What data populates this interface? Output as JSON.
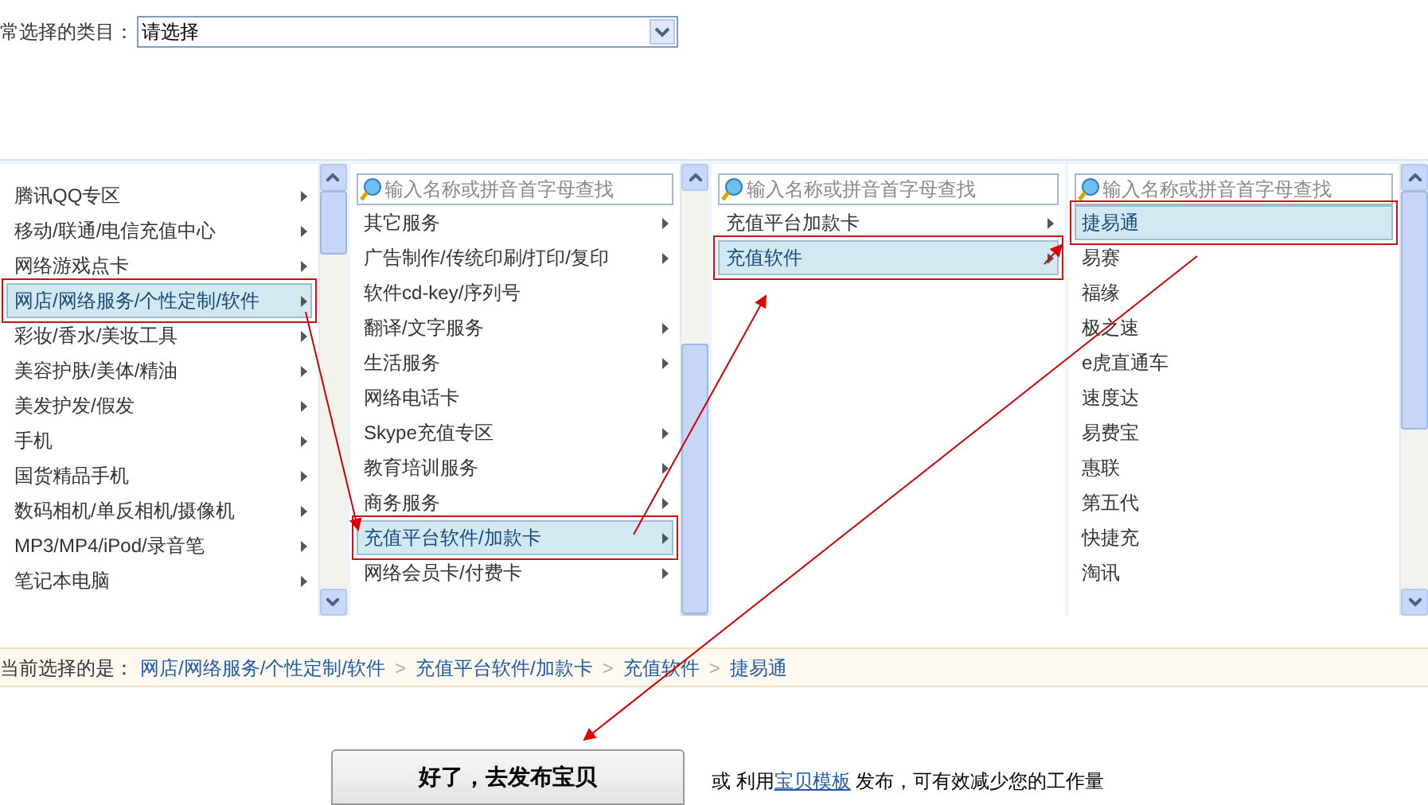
{
  "category_select": {
    "label": "常选择的类目：",
    "value": "请选择"
  },
  "columns": [
    {
      "scrollbar": true,
      "items": [
        {
          "label": "腾讯QQ专区",
          "has_children": true,
          "selected": false
        },
        {
          "label": "移动/联通/电信充值中心",
          "has_children": true,
          "selected": false
        },
        {
          "label": "网络游戏点卡",
          "has_children": true,
          "selected": false
        },
        {
          "label": "网店/网络服务/个性定制/软件",
          "has_children": true,
          "selected": true
        },
        {
          "label": "彩妆/香水/美妆工具",
          "has_children": true,
          "selected": false
        },
        {
          "label": "美容护肤/美体/精油",
          "has_children": true,
          "selected": false
        },
        {
          "label": "美发护发/假发",
          "has_children": true,
          "selected": false
        },
        {
          "label": "手机",
          "has_children": true,
          "selected": false
        },
        {
          "label": "国货精品手机",
          "has_children": true,
          "selected": false
        },
        {
          "label": "数码相机/单反相机/摄像机",
          "has_children": true,
          "selected": false
        },
        {
          "label": "MP3/MP4/iPod/录音笔",
          "has_children": true,
          "selected": false
        },
        {
          "label": "笔记本电脑",
          "has_children": true,
          "selected": false
        }
      ]
    },
    {
      "search_placeholder": "输入名称或拼音首字母查找",
      "scrollbar": true,
      "items": [
        {
          "label": "其它服务",
          "has_children": true,
          "selected": false
        },
        {
          "label": "广告制作/传统印刷/打印/复印",
          "has_children": true,
          "selected": false
        },
        {
          "label": "软件cd-key/序列号",
          "has_children": false,
          "selected": false
        },
        {
          "label": "翻译/文字服务",
          "has_children": true,
          "selected": false
        },
        {
          "label": "生活服务",
          "has_children": true,
          "selected": false
        },
        {
          "label": "网络电话卡",
          "has_children": false,
          "selected": false
        },
        {
          "label": "Skype充值专区",
          "has_children": true,
          "selected": false
        },
        {
          "label": "教育培训服务",
          "has_children": true,
          "selected": false
        },
        {
          "label": "商务服务",
          "has_children": true,
          "selected": false
        },
        {
          "label": "充值平台软件/加款卡",
          "has_children": true,
          "selected": true
        },
        {
          "label": "网络会员卡/付费卡",
          "has_children": true,
          "selected": false
        }
      ]
    },
    {
      "search_placeholder": "输入名称或拼音首字母查找",
      "scrollbar": false,
      "items": [
        {
          "label": "充值平台加款卡",
          "has_children": true,
          "selected": false
        },
        {
          "label": "充值软件",
          "has_children": true,
          "selected": true
        }
      ]
    },
    {
      "search_placeholder": "输入名称或拼音首字母查找",
      "scrollbar": true,
      "items": [
        {
          "label": "捷易通",
          "has_children": false,
          "selected": true
        },
        {
          "label": "易赛",
          "has_children": false,
          "selected": false
        },
        {
          "label": "福缘",
          "has_children": false,
          "selected": false
        },
        {
          "label": "极之速",
          "has_children": false,
          "selected": false
        },
        {
          "label": "e虎直通车",
          "has_children": false,
          "selected": false
        },
        {
          "label": "速度达",
          "has_children": false,
          "selected": false
        },
        {
          "label": "易费宝",
          "has_children": false,
          "selected": false
        },
        {
          "label": "惠联",
          "has_children": false,
          "selected": false
        },
        {
          "label": "第五代",
          "has_children": false,
          "selected": false
        },
        {
          "label": "快捷充",
          "has_children": false,
          "selected": false
        },
        {
          "label": "淘讯",
          "has_children": false,
          "selected": false
        }
      ]
    }
  ],
  "breadcrumb": {
    "label": "当前选择的是：",
    "separator": ">",
    "path": [
      "网店/网络服务/个性定制/软件",
      "充值平台软件/加款卡",
      "充值软件",
      "捷易通"
    ]
  },
  "footer": {
    "button": "好了，去发布宝贝",
    "note_before": "或 利用",
    "link": "宝贝模板",
    "note_after": "发布，可有效减少您的工作量"
  }
}
